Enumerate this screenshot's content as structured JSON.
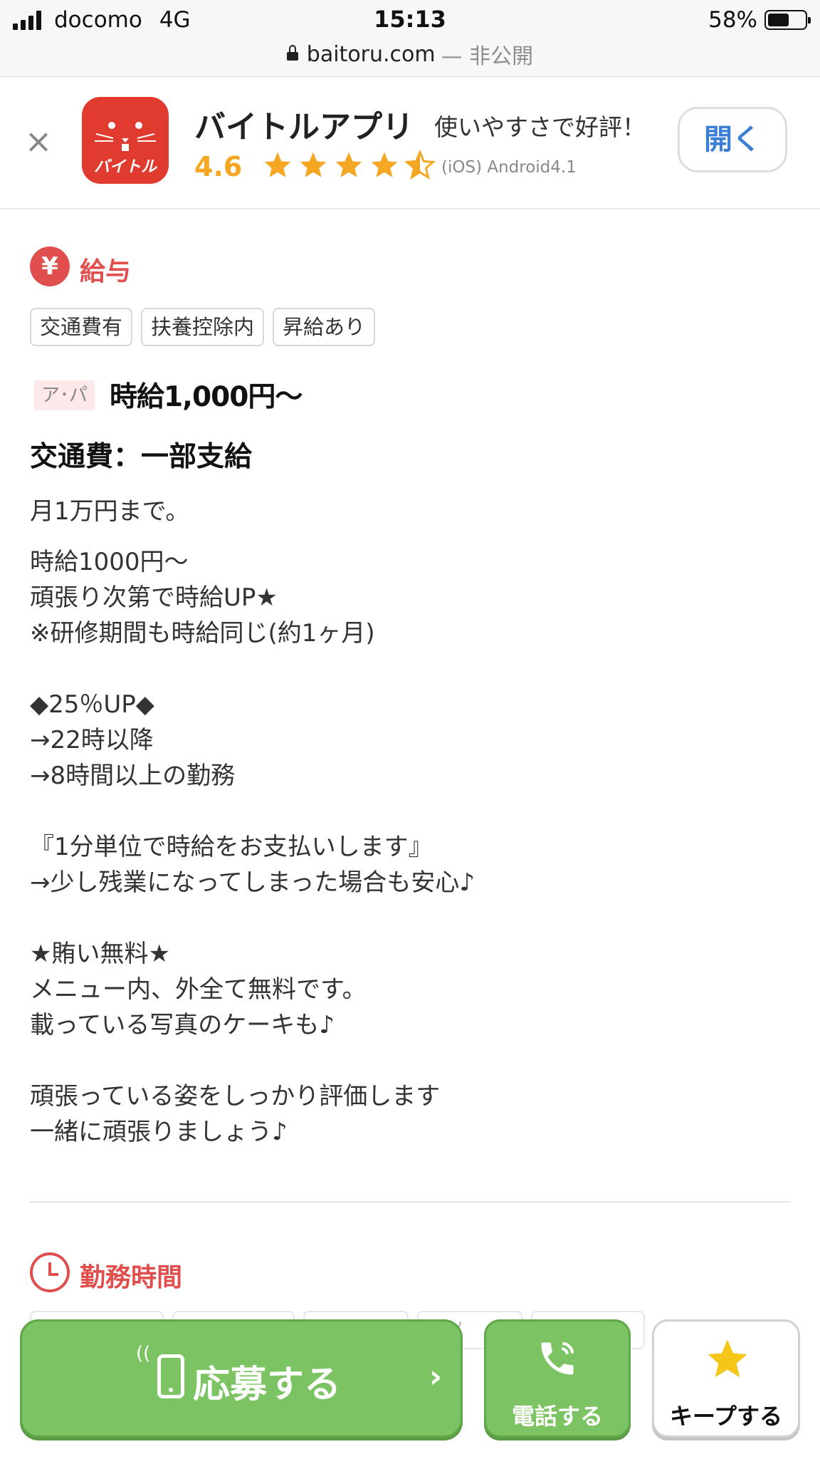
{
  "status_bar": {
    "carrier": "docomo",
    "network": "4G",
    "time": "15:13",
    "battery_percent": "58%",
    "battery_level": 0.58
  },
  "address_bar": {
    "domain": "baitoru.com",
    "suffix": "— 非公開"
  },
  "app_banner": {
    "close_icon": "close-icon",
    "app_icon_text": "バイトル",
    "app_name": "バイトルアプリ",
    "tagline": "使いやすさで好評！",
    "rating": "4.6",
    "stars": 4.5,
    "platforms": "(iOS)  Android4.1",
    "open_button": "開く",
    "star_color": "#f5a623",
    "open_color": "#3a7fd5"
  },
  "salary": {
    "section_icon": "yen-icon",
    "section_title": "給与",
    "tags": [
      "交通費有",
      "扶養控除内",
      "昇給あり"
    ],
    "wage_badge": "ア･パ",
    "wage_value": "時給1,000円〜",
    "transport_heading": "交通費：一部支給",
    "transport_note": "月1万円まで。",
    "body_lines": [
      "時給1000円〜",
      "頑張り次第で時給UP★",
      "※研修期間も時給同じ(約1ヶ月)",
      "",
      "◆25％UP◆",
      "→22時以降",
      "→8時間以上の勤務",
      "",
      "『1分単位で時給をお支払いします』",
      "→少し残業になってしまった場合も安心♪",
      "",
      "★賄い無料★",
      "メニュー内、外全て無料です。",
      "載っている写真のケーキも♪",
      "",
      "頑張っている姿をしっかり評価します",
      "一緒に頑張りましょう♪"
    ],
    "accent_color": "#e04e4e"
  },
  "work_hours": {
    "section_icon": "clock-icon",
    "section_title": "勤務時間",
    "tags_partial": [
      "",
      "",
      "",
      "Ch/",
      "K"
    ],
    "peek_text": ":0"
  },
  "actions": {
    "apply_label": "応募する",
    "call_label": "電話する",
    "keep_label": "キープする",
    "primary_color": "#7cc463"
  }
}
